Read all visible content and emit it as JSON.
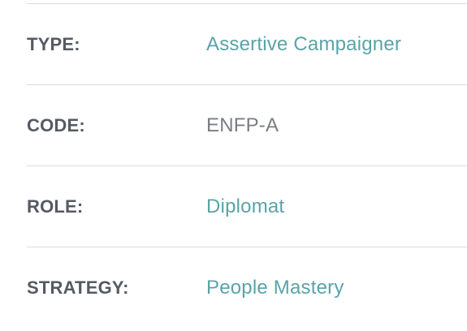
{
  "rows": [
    {
      "label": "TYPE:",
      "value": "Assertive Campaigner",
      "is_link": true
    },
    {
      "label": "CODE:",
      "value": "ENFP-A",
      "is_link": false
    },
    {
      "label": "ROLE:",
      "value": "Diplomat",
      "is_link": true
    },
    {
      "label": "STRATEGY:",
      "value": "People Mastery",
      "is_link": true
    }
  ],
  "colors": {
    "label": "#555a63",
    "link": "#5aa3a8",
    "plain": "#7a7d82",
    "divider": "#dcdcdc"
  }
}
